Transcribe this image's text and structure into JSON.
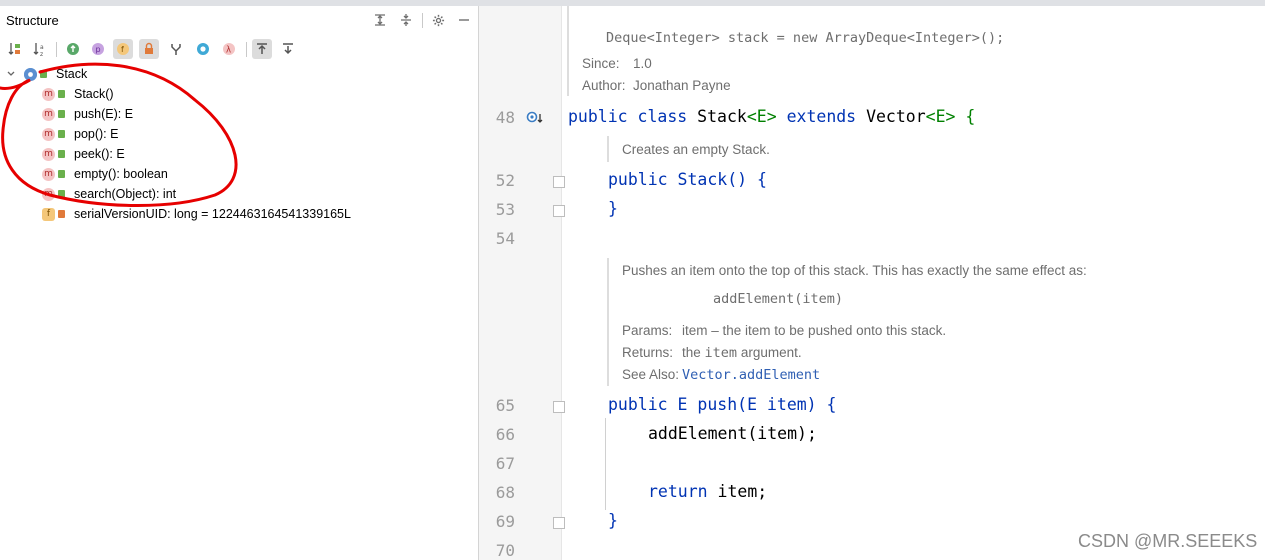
{
  "structure": {
    "title": "Structure",
    "header_icons": [
      "expand-all-icon",
      "collapse-all-icon",
      "gear-icon",
      "minimize-icon"
    ],
    "toolbar_icons": [
      "sort-by-visibility-icon",
      "sort-alphabetically-icon",
      "show-inherited-icon",
      "show-properties-icon",
      "show-fields-icon",
      "show-non-public-icon",
      "show-anonymous-classes-icon",
      "show-lambdas-icon",
      "show-lambda-icon",
      "autoscroll-to-source-icon",
      "autoscroll-from-source-icon"
    ],
    "class_name": "Stack",
    "members": [
      {
        "label": "Stack()",
        "kind": "m"
      },
      {
        "label": "push(E): E",
        "kind": "m"
      },
      {
        "label": "pop(): E",
        "kind": "m"
      },
      {
        "label": "peek(): E",
        "kind": "m"
      },
      {
        "label": "empty(): boolean",
        "kind": "m"
      },
      {
        "label": "search(Object): int",
        "kind": "m"
      },
      {
        "label": "serialVersionUID: long = 1224463164541339165L",
        "kind": "f"
      }
    ],
    "badge_m": "m",
    "badge_f": "f"
  },
  "editor": {
    "doc1_code": "Deque<Integer> stack = new ArrayDeque<Integer>();",
    "since_label": "Since:",
    "since_value": "1.0",
    "author_label": "Author:",
    "author_value": "Jonathan Payne",
    "ln48": "48",
    "ln52": "52",
    "ln53": "53",
    "ln54": "54",
    "ln65": "65",
    "ln66": "66",
    "ln67": "67",
    "ln68": "68",
    "ln69": "69",
    "ln70": "70",
    "line48": {
      "k1": "public",
      "k2": "class",
      "name": "Stack",
      "tp1": "<E>",
      "k3": "extends",
      "sup": "Vector",
      "tp2": "<E>",
      "brace": " {"
    },
    "doc2": "Creates an empty Stack.",
    "line52": {
      "k1": "public",
      "rest": "Stack() {"
    },
    "line53": "}",
    "doc3_text": "Pushes an item onto the top of this stack. This has exactly the same effect as:",
    "doc3_code": "addElement(item)",
    "params_label": "Params:",
    "params_value": "item – the item to be pushed onto this stack.",
    "returns_label": "Returns:",
    "returns_pre": "the",
    "returns_code": "item",
    "returns_post": "argument.",
    "seealso_label": "See Also:",
    "seealso_link": "Vector.addElement",
    "line65": {
      "k1": "public",
      "rest": "E push(E item) {"
    },
    "line66": "addElement(item);",
    "line68": {
      "k1": "return",
      "rest": " item;"
    },
    "line69": "}"
  },
  "watermark": "CSDN @MR.SEEEKS",
  "colors": {
    "keyword": "#0033b3",
    "type_param": "#008000",
    "annotation_red": "#e60000"
  }
}
